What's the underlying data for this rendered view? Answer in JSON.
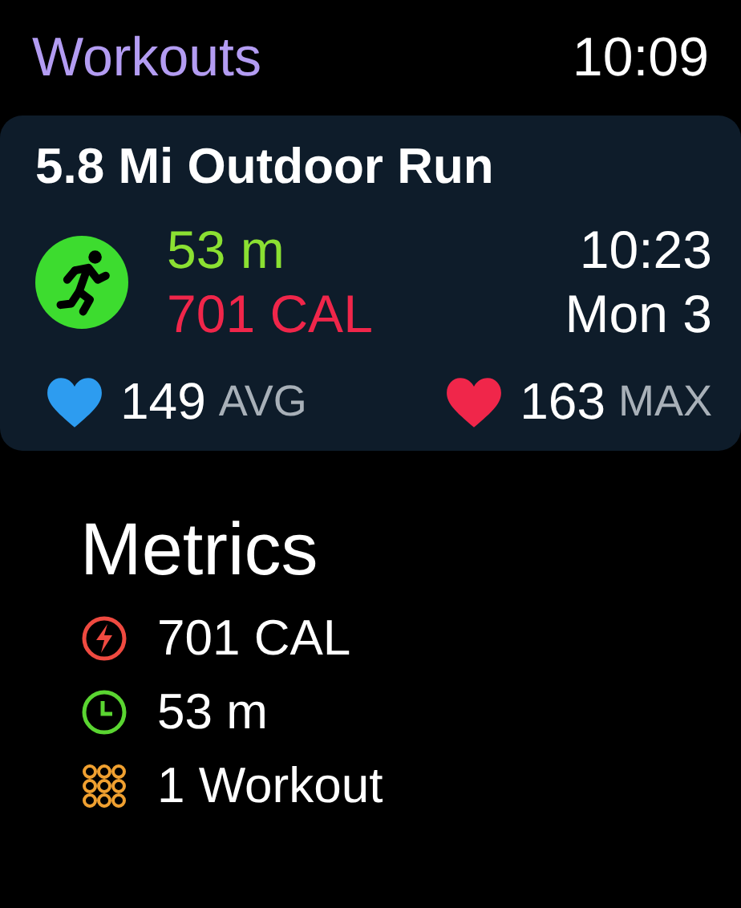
{
  "header": {
    "title": "Workouts",
    "time": "10:09"
  },
  "workout": {
    "title": "5.8 Mi Outdoor Run",
    "kind": "run",
    "duration": "53 m",
    "calories": "701 CAL",
    "start_time": "10:23",
    "date": "Mon 3",
    "heart_rates": [
      {
        "kind": "avg",
        "value": "149",
        "label": "AVG"
      },
      {
        "kind": "max",
        "value": "163",
        "label": "MAX"
      }
    ]
  },
  "metrics": {
    "heading": "Metrics",
    "items": [
      {
        "kind": "calories",
        "text": "701 CAL"
      },
      {
        "kind": "time",
        "text": "53 m"
      },
      {
        "kind": "count",
        "text": "1 Workout"
      }
    ]
  }
}
